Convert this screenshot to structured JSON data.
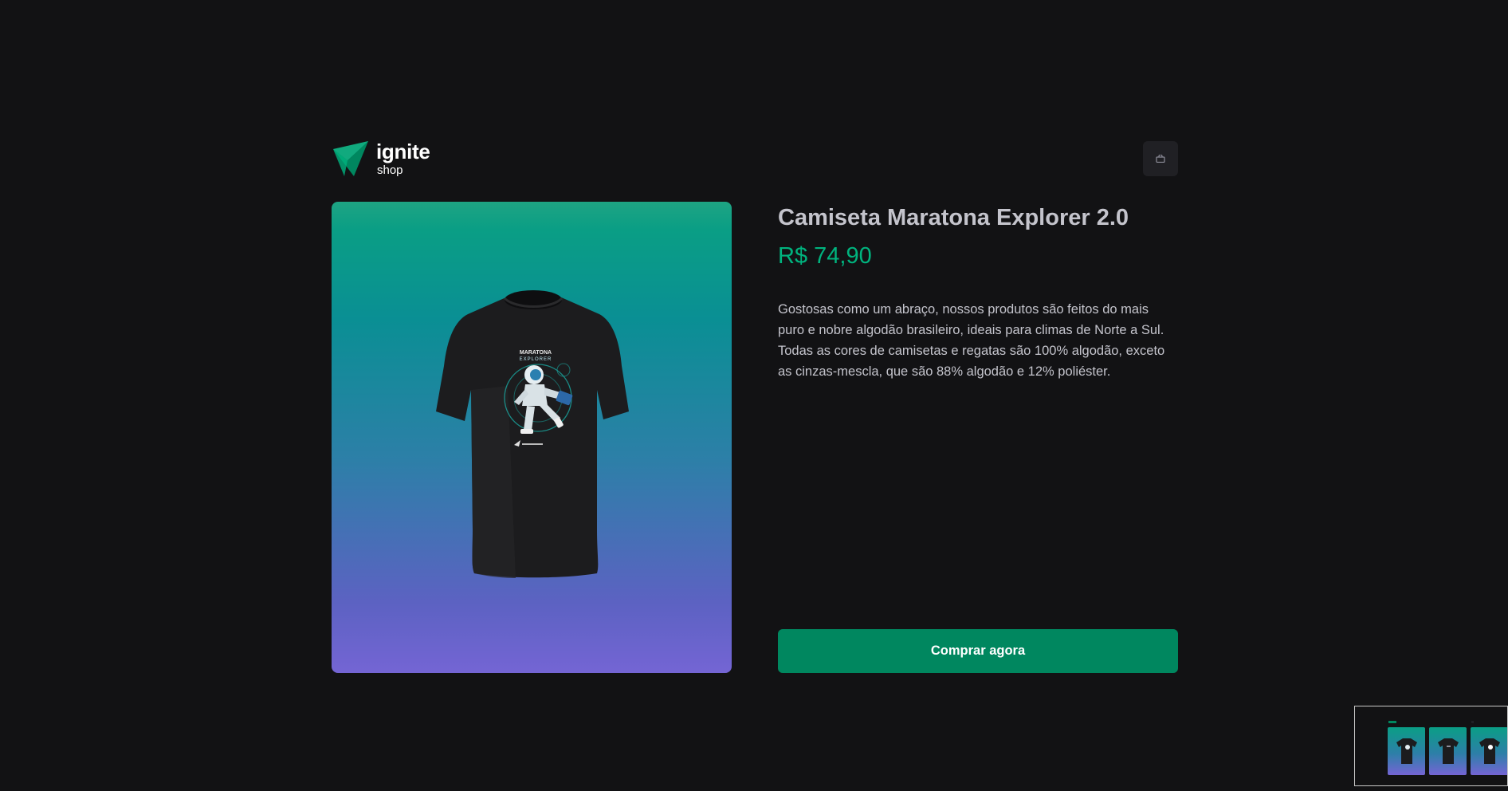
{
  "brand": {
    "name": "ignite",
    "sub": "shop",
    "colors": {
      "green": "#00875f",
      "light_green": "#00b37e"
    }
  },
  "header": {
    "cart_icon": "shopping-bag-icon"
  },
  "product": {
    "title": "Camiseta Maratona Explorer 2.0",
    "price": "R$ 74,90",
    "description": "Gostosas como um abraço, nossos produtos são feitos do mais puro e nobre algodão brasileiro, ideais para climas de Norte a Sul. Todas as cores de camisetas e regatas são 100% algodão, exceto as cinzas-mescla, que são 88% algodão e 12% poliéster.",
    "buy_label": "Comprar agora",
    "shirt_print_line1": "MARATONA",
    "shirt_print_line2": "EXPLORER"
  },
  "minimap": {
    "thumbnail_count": 3
  }
}
